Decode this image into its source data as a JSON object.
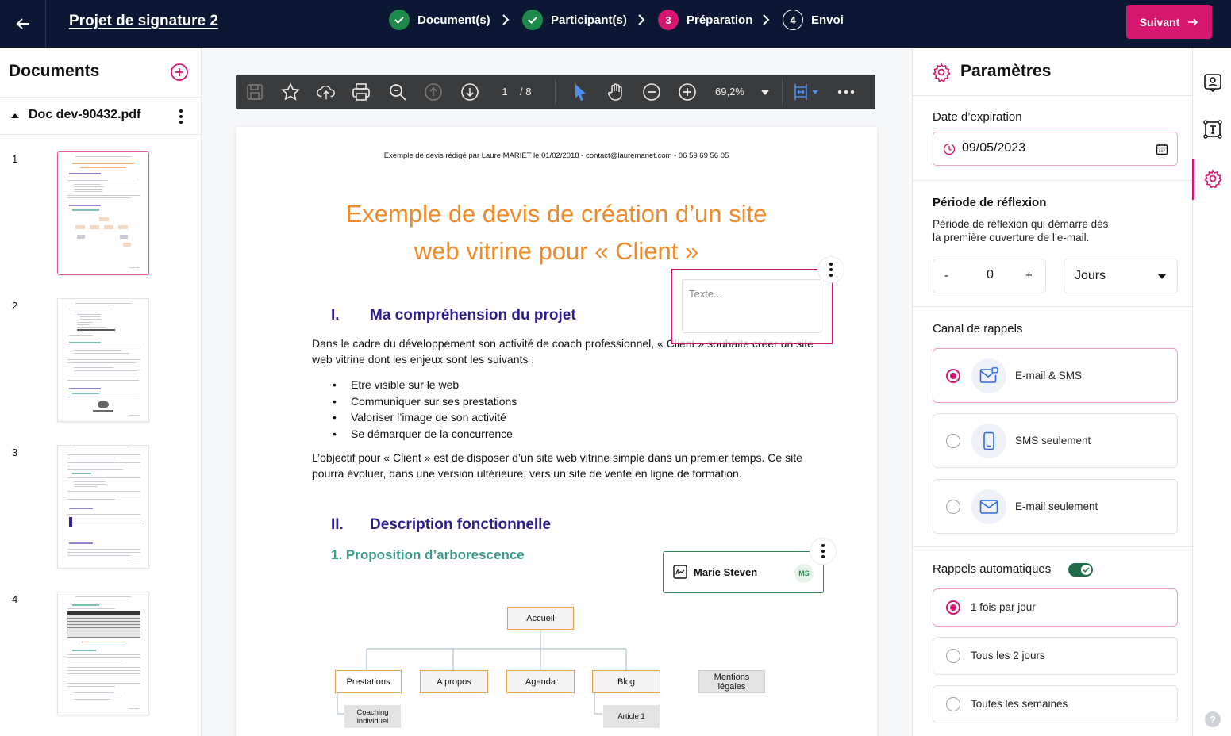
{
  "topbar": {
    "title": "Projet de signature 2",
    "next_label": "Suivant",
    "steps": [
      {
        "num": "",
        "label": "Document(s)"
      },
      {
        "num": "",
        "label": "Participant(s)"
      },
      {
        "num": "3",
        "label": "Préparation"
      },
      {
        "num": "4",
        "label": "Envoi"
      }
    ]
  },
  "sidebar": {
    "title": "Documents",
    "doc_name": "Doc dev-90432.pdf",
    "pages": [
      "1",
      "2",
      "3",
      "4"
    ]
  },
  "viewer": {
    "page": "1",
    "total": "/ 8",
    "zoom": "69,2%"
  },
  "document": {
    "header": "Exemple de devis rédigé par Laure MARIET le 01/02/2018 - contact@lauremariet.com - 06 59 69 56 05",
    "title1": "Exemple de devis de création d’un site",
    "title2": "web vitrine pour « Client »",
    "s1_num": "I.",
    "s1_title": "Ma compréhension du projet",
    "p1_line1": "Dans le cadre du développement son activité de coach professionnel, « Client » souhaite créer un site",
    "p1_line2": "web vitrine dont les enjeux sont les suivants :",
    "bullets": [
      "Etre visible sur le web",
      "Communiquer sur ses prestations",
      "Valoriser l’image de son activité",
      "Se démarquer de la concurrence"
    ],
    "p2_line1": "L’objectif pour « Client » est de disposer d’un site web vitrine simple dans un premier temps. Ce site",
    "p2_line2": "pourra évoluer, dans une version ultérieure, vers un site de vente en ligne de formation.",
    "s2_num": "II.",
    "s2_title": "Description fonctionnelle",
    "s2_sub": "1.  Proposition d’arborescence",
    "tree": {
      "root": "Accueil",
      "items": [
        "Prestations",
        "A propos",
        "Agenda",
        "Blog",
        "Mentions légales"
      ],
      "sub1": "Coaching individuel",
      "sub2": "Article 1"
    }
  },
  "fields": {
    "text_placeholder": "Texte...",
    "signer_name": "Marie Steven",
    "signer_initials": "MS"
  },
  "settings": {
    "title": "Paramètres",
    "expiration_label": "Date d’expiration",
    "expiration_value": "09/05/2023",
    "reflection_label": "Période de réflexion",
    "reflection_desc1": "Période de réflexion qui démarre dès",
    "reflection_desc2": "la première ouverture de l’e-mail.",
    "minus": "-",
    "count": "0",
    "plus": "+",
    "unit": "Jours",
    "channel_label": "Canal de rappels",
    "channels": [
      {
        "label": "E-mail & SMS",
        "selected": true
      },
      {
        "label": "SMS seulement",
        "selected": false
      },
      {
        "label": "E-mail seulement",
        "selected": false
      }
    ],
    "auto_label": "Rappels automatiques",
    "auto_enabled": true,
    "frequencies": [
      {
        "label": "1 fois par jour",
        "selected": true
      },
      {
        "label": "Tous les 2 jours",
        "selected": false
      },
      {
        "label": "Toutes les semaines",
        "selected": false
      }
    ]
  },
  "colors": {
    "brand": "#d6176f",
    "navy": "#0b1733",
    "orange_title": "#ef8a2b",
    "section": "#2b1e8f",
    "teal": "#3a9a8c",
    "toggle": "#1f6b4a"
  }
}
